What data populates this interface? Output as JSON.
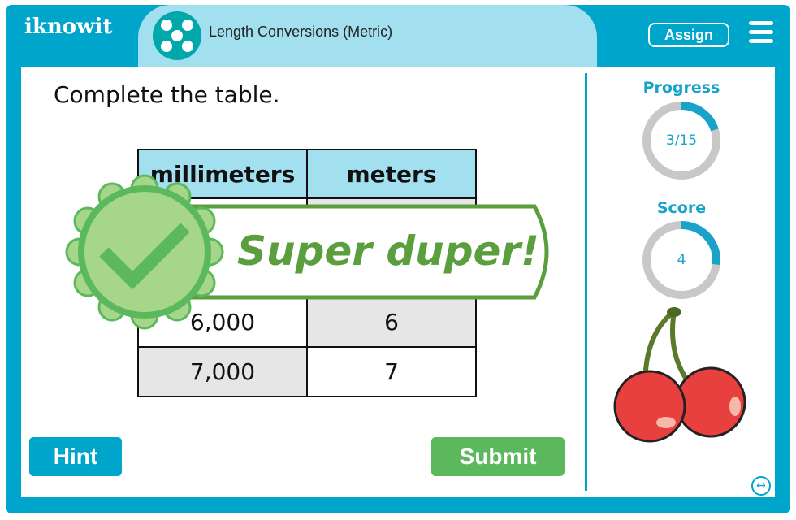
{
  "header": {
    "logo": "iknowit",
    "lesson_title": "Length Conversions (Metric)",
    "assign_label": "Assign",
    "menu_icon": "hamburger-icon",
    "lesson_icon": "dots-icon"
  },
  "main": {
    "prompt": "Complete the table.",
    "table": {
      "headers": [
        "millimeters",
        "meters"
      ],
      "rows": [
        [
          "",
          ""
        ],
        [
          "",
          ""
        ],
        [
          "6,000",
          "6"
        ],
        [
          "7,000",
          "7"
        ]
      ]
    },
    "hint_label": "Hint",
    "submit_label": "Submit"
  },
  "feedback": {
    "message": "Super duper!",
    "icon": "checkmark-badge-icon"
  },
  "sidebar": {
    "progress_label": "Progress",
    "progress_text": "3/15",
    "progress_fraction": 0.2,
    "score_label": "Score",
    "score_text": "4",
    "score_fraction": 0.27,
    "reward_image": "cherries"
  },
  "colors": {
    "brand": "#00a5cb",
    "tab": "#a2dfef",
    "submit": "#5cb85c",
    "feedback": "#5a9e3e"
  }
}
